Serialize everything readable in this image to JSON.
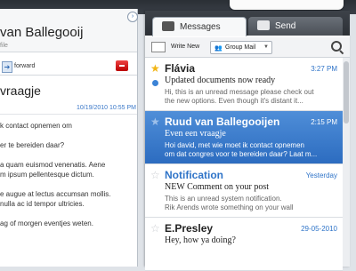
{
  "reader": {
    "contact_name": "van Ballegooij",
    "contact_sub": "file",
    "toolbar": {
      "forward_label": "forward"
    },
    "subject": "vraagje",
    "date": "10/19/2010 10:55 PM",
    "body_lines": [
      "k contact opnemen om",
      "er te bereiden daar?",
      "a quam euismod venenatis. Aene",
      "m ipsum pellentesque dictum.",
      "e augue at lectus accumsan mollis.",
      "nulla ac id tempor ultricies.",
      "ag of morgen eventjes weten."
    ]
  },
  "tabs": {
    "messages_label": "Messages",
    "send_label": "Send"
  },
  "list_toolbar": {
    "write_new_label": "Write New",
    "group_mail_label": "Group Mail"
  },
  "messages": [
    {
      "sender": "Flávia",
      "time": "3:27 PM",
      "subject": "Updated documents now ready",
      "preview1": "Hi, this is an unread message please check out",
      "preview2": "the new options. Even though it's distant it...",
      "starred": true,
      "unread": true,
      "selected": false,
      "sender_blue": false
    },
    {
      "sender": "Ruud van Ballegooijen",
      "time": "2:15 PM",
      "subject": "Even een vraagje",
      "preview1": "Hoi david, met wie moet ik contact opnemen",
      "preview2": "om dat congres voor te bereiden daar? Laat m...",
      "starred": false,
      "unread": false,
      "selected": true,
      "sender_blue": false
    },
    {
      "sender": "Notification",
      "time": "Yesterday",
      "subject": "NEW Comment on your post",
      "preview1": "This is an unread system notification.",
      "preview2": "Rik Arends wrote something on your wall",
      "starred": false,
      "unread": false,
      "selected": false,
      "sender_blue": true
    },
    {
      "sender": "E.Presley",
      "time": "29-05-2010",
      "subject": "Hey, how ya doing?",
      "preview1": "",
      "preview2": "",
      "starred": false,
      "unread": false,
      "selected": false,
      "sender_blue": false
    }
  ]
}
